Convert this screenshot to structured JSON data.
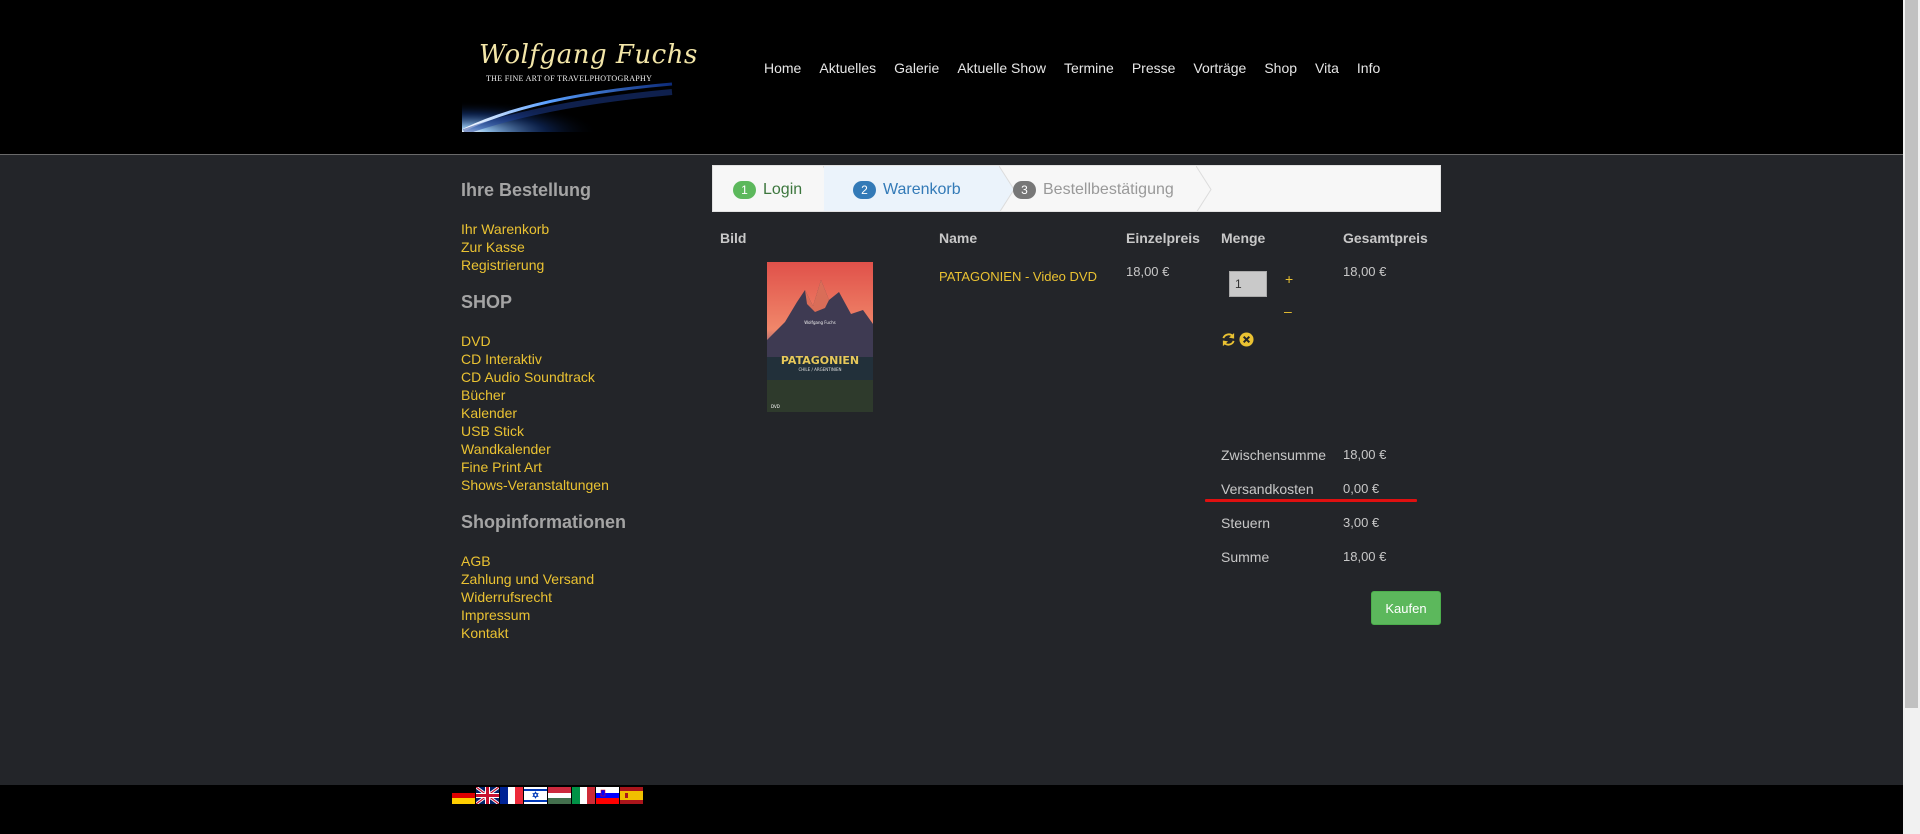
{
  "logo": {
    "title": "Wolfgang Fuchs",
    "subtitle": "THE FINE ART OF TRAVELPHOTOGRAPHY"
  },
  "nav": [
    "Home",
    "Aktuelles",
    "Galerie",
    "Aktuelle Show",
    "Termine",
    "Presse",
    "Vorträge",
    "Shop",
    "Vita",
    "Info"
  ],
  "sidebar": {
    "order_heading": "Ihre Bestellung",
    "order_links": [
      "Ihr Warenkorb",
      "Zur Kasse",
      "Registrierung"
    ],
    "shop_heading": "SHOP",
    "shop_links": [
      "DVD",
      "CD Interaktiv",
      "CD Audio Soundtrack",
      "Bücher",
      "Kalender",
      "USB Stick",
      "Wandkalender",
      "Fine Print Art",
      "Shows-Veranstaltungen"
    ],
    "info_heading": "Shopinformationen",
    "info_links": [
      "AGB",
      "Zahlung und Versand",
      "Widerrufsrecht",
      "Impressum",
      "Kontakt"
    ]
  },
  "steps": [
    {
      "num": "1",
      "label": "Login",
      "color": "#5cb85c",
      "text_color": "#3c763d"
    },
    {
      "num": "2",
      "label": "Warenkorb",
      "color": "#337ab7",
      "text_color": "#337ab7"
    },
    {
      "num": "3",
      "label": "Bestellbestätigung",
      "color": "#777777",
      "text_color": "#999999"
    }
  ],
  "table": {
    "headers": {
      "image": "Bild",
      "name": "Name",
      "unit_price": "Einzelpreis",
      "quantity": "Menge",
      "total": "Gesamtpreis"
    },
    "item": {
      "name": "PATAGONIEN - Video DVD",
      "unit_price": "18,00 €",
      "quantity": "1",
      "total": "18,00 €",
      "cover_title": "PATAGONIEN",
      "cover_subtitle": "CHILE / ARGENTINIEN",
      "cover_author": "Wolfgang Fuchs",
      "cover_badge": "DVD"
    },
    "plus": "+",
    "minus": "–"
  },
  "summary": [
    {
      "label": "Zwischensumme",
      "value": "18,00 €"
    },
    {
      "label": "Versandkosten",
      "value": "0,00 €"
    },
    {
      "label": "Steuern",
      "value": "3,00 €"
    },
    {
      "label": "Summe",
      "value": "18,00 €"
    }
  ],
  "buy_label": "Kaufen",
  "flags": [
    "german-flag-icon",
    "british-flag-icon",
    "french-flag-icon",
    "israeli-flag-icon",
    "hungarian-flag-icon",
    "italian-flag-icon",
    "slovenian-flag-icon",
    "spanish-flag-icon"
  ],
  "colors": {
    "link": "#eac232",
    "buy": "#5cb85c",
    "highlight": "#e01010"
  }
}
